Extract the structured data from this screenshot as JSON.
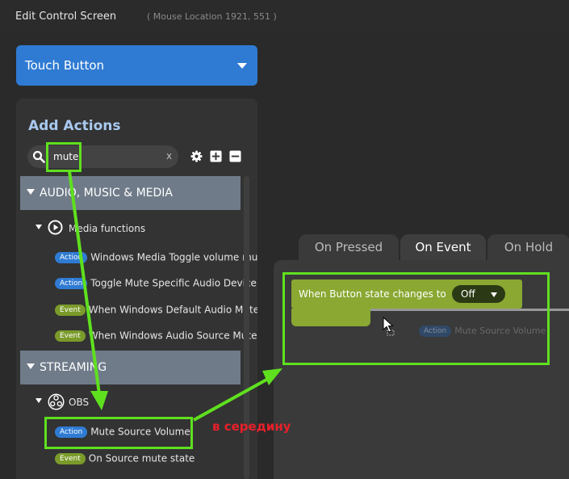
{
  "header": {
    "title": "Edit Control Screen",
    "mouse_location": "( Mouse Location 1921, 551 )"
  },
  "device_dropdown": {
    "value": "Touch Button"
  },
  "actions": {
    "title": "Add Actions",
    "search_value": "mute",
    "search_clear": "x",
    "categories": [
      {
        "label": "AUDIO, MUSIC & MEDIA",
        "group": "Media functions",
        "items": [
          {
            "badge": "Action",
            "label": "Windows Media Toggle volume mu"
          },
          {
            "badge": "Action",
            "label": "Toggle Mute Specific Audio Device"
          },
          {
            "badge": "Event",
            "label": "When Windows Default Audio Mute"
          },
          {
            "badge": "Event",
            "label": "When Windows Audio Source Mute"
          }
        ]
      },
      {
        "label": "STREAMING",
        "group": "OBS",
        "items": [
          {
            "badge": "Action",
            "label": "Mute Source Volume"
          },
          {
            "badge": "Event",
            "label": "On Source mute state"
          }
        ]
      }
    ]
  },
  "tabs": [
    "On Pressed",
    "On Event",
    "On Hold"
  ],
  "event": {
    "trigger_label": "When Button state changes to",
    "state_value": "Off",
    "drag_badge": "Action",
    "drag_label": "Mute Source Volume"
  },
  "annotation": {
    "text": "в середину"
  },
  "colors": {
    "accent_blue": "#2f7bd3",
    "event_green": "#8aa832",
    "highlight_green": "#5fe01f",
    "annotation_red": "#e8202a"
  }
}
